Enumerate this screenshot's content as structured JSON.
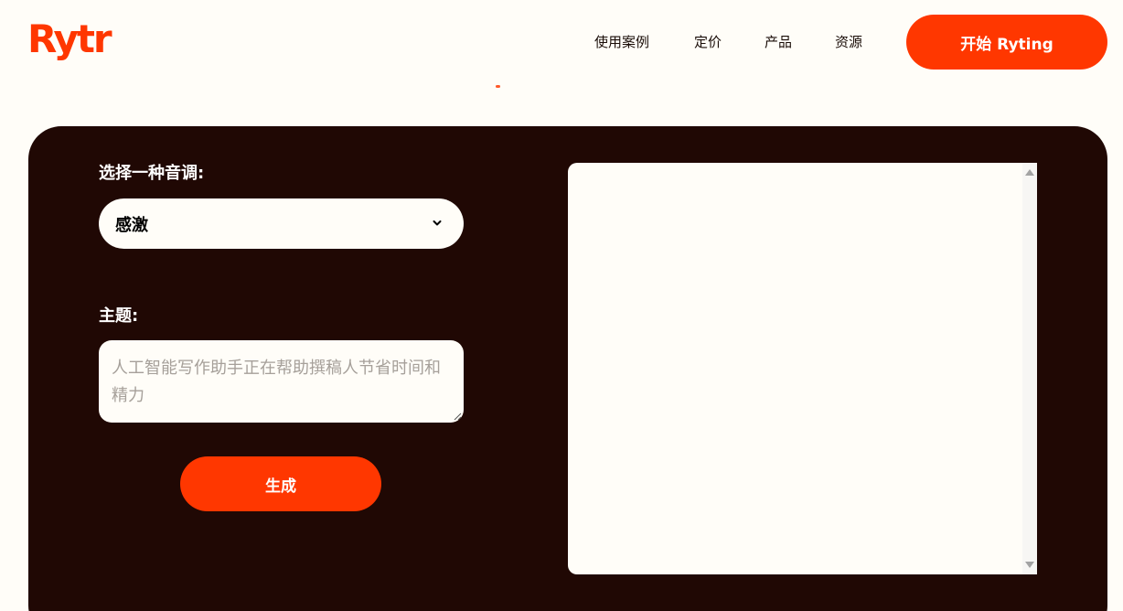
{
  "header": {
    "logo_text": "Rytr",
    "nav": [
      "使用案例",
      "定价",
      "产品",
      "资源"
    ],
    "cta_label": "开始 Ryting"
  },
  "form": {
    "tone_label": "选择一种音调:",
    "tone_selected": "感激",
    "topic_label": "主题:",
    "topic_placeholder": "人工智能写作助手正在帮助撰稿人节省时间和精力",
    "generate_label": "生成"
  },
  "output": {
    "text": ""
  },
  "colors": {
    "brand": "#ff3700",
    "panel": "#200804",
    "background": "#fffdf8"
  },
  "icons": [
    "chevron-down-icon",
    "scroll-up-icon",
    "scroll-down-icon",
    "resize-grip-icon"
  ]
}
